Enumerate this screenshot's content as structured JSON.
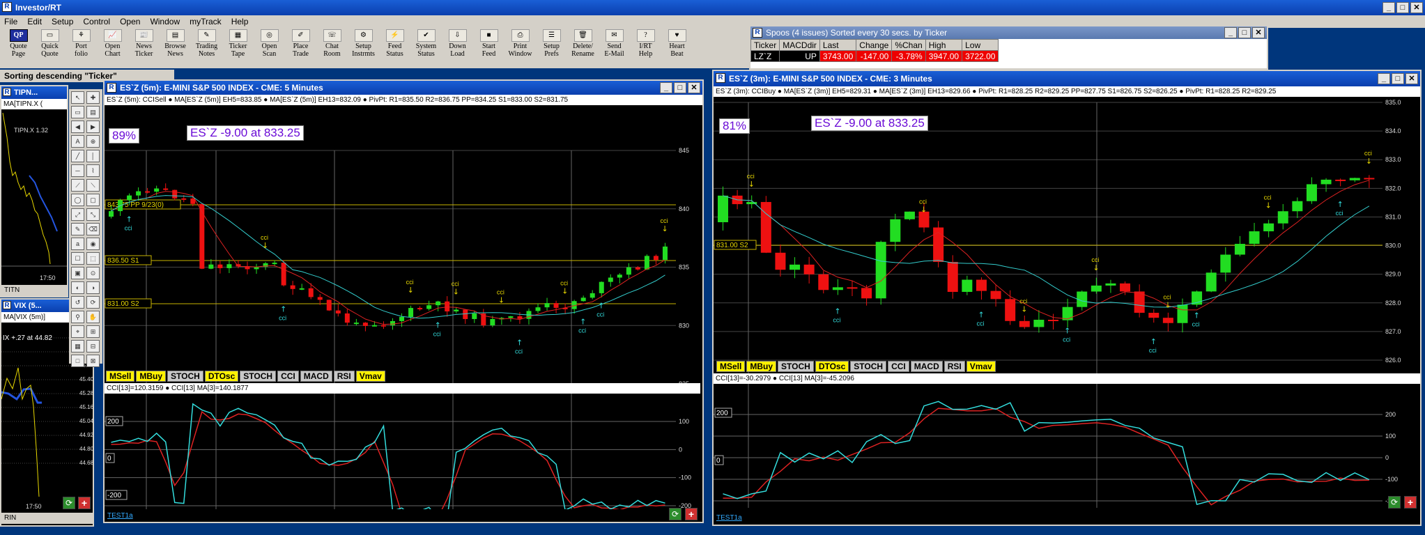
{
  "app": {
    "title": "Investor/RT"
  },
  "menu": [
    "File",
    "Edit",
    "Setup",
    "Control",
    "Open",
    "Window",
    "myTrack",
    "Help"
  ],
  "toolbar": [
    [
      "Quote",
      "Page",
      "QP"
    ],
    [
      "Quick",
      "Quote",
      "▭"
    ],
    [
      "Port",
      "folio",
      "⚘"
    ],
    [
      "Open",
      "Chart",
      "📈"
    ],
    [
      "News",
      "Ticker",
      "📰"
    ],
    [
      "Browse",
      "News",
      "▤"
    ],
    [
      "Trading",
      "Notes",
      "✎"
    ],
    [
      "Ticker",
      "Tape",
      "▦"
    ],
    [
      "Open",
      "Scan",
      "◎"
    ],
    [
      "Place",
      "Trade",
      "✐"
    ],
    [
      "Chat",
      "Room",
      "☏"
    ],
    [
      "Setup",
      "Instrmts",
      "⚙"
    ],
    [
      "Feed",
      "Status",
      "⚡"
    ],
    [
      "System",
      "Status",
      "✔"
    ],
    [
      "Down",
      "Load",
      "⇩"
    ],
    [
      "Start",
      "Feed",
      "■"
    ],
    [
      "Print",
      "Window",
      "⎙"
    ],
    [
      "Setup",
      "Prefs",
      "☰"
    ],
    [
      "Delete/",
      "Rename",
      "🗑"
    ],
    [
      "Send",
      "E-Mail",
      "✉"
    ],
    [
      "I/RT",
      "Help",
      "?"
    ],
    [
      "Heart",
      "Beat",
      "♥"
    ]
  ],
  "sort_text": "Sorting descending \"Ticker\"",
  "quote_win": {
    "title": "Spoos (4 issues) Sorted every 30 secs. by Ticker",
    "headers": [
      "Ticker",
      "MACDdir",
      "Last",
      "Change",
      "%Chan",
      "High",
      "Low"
    ],
    "row": [
      "LZ`Z",
      "UP",
      "3743.00",
      "-147.00",
      "-3.78%",
      "3947.00",
      "3722.00"
    ]
  },
  "tipn": {
    "title": "TIPN...",
    "ma": "MA[TIPN.X (",
    "price": "TIPN.X 1.32",
    "time": "17:50",
    "status": "TITN"
  },
  "vix": {
    "title": "VIX (5...",
    "ma": "MA[VIX (5m)]",
    "change": "IX +.27 at 44.82",
    "ticks": [
      "45.76",
      "45.64",
      "45.52",
      "45.40",
      "45.28",
      "45.16",
      "45.04",
      "44.92",
      "44.80",
      "44.68"
    ],
    "time": "17:50",
    "status": "RIN"
  },
  "chart5": {
    "title": "ES`Z (5m): E-MINI S&P 500 INDEX - CME: 5 Minutes",
    "legend": "ES`Z (5m): CCISell  ● MA[ES`Z (5m)] EH5=833.85  ● MA[ES`Z (5m)] EH13=832.09  ● PivPt: R1=835.50 R2=836.75 PP=834.25 S1=833.00 S2=831.75",
    "pct": "89%",
    "info": "ES`Z -9.00 at 833.25",
    "hlines": [
      "843.75 PP 9/23(0)",
      "836.50 S1",
      "831.00 S2"
    ],
    "yticks": [
      "845",
      "840",
      "835",
      "830",
      "825"
    ],
    "xticks": [
      "20:30",
      "14:30",
      "15:30",
      "16:30",
      "17:30"
    ],
    "tabs": [
      "MSell",
      "MBuy",
      "STOCH",
      "DTOsc",
      "STOCH",
      "CCI",
      "MACD",
      "RSI",
      "Vmav"
    ],
    "cci_legend": "CCI[13]=120.3159  ● CCI[13] MA[3]=140.1877",
    "cci_marks": [
      "200",
      "0",
      "-200"
    ],
    "cci_yticks": [
      "100",
      "0",
      "-100",
      "-200"
    ],
    "status": "TEST1a"
  },
  "chart3": {
    "title": "ES`Z (3m): E-MINI S&P 500 INDEX - CME: 3 Minutes",
    "legend": "ES`Z (3m): CCIBuy  ● MA[ES`Z (3m)] EH5=829.31  ● MA[ES`Z (3m)] EH13=829.66  ● PivPt: R1=828.25 R2=829.25 PP=827.75 S1=826.75 S2=826.25  ● PivPt: R1=828.25 R2=829.25",
    "pct": "81%",
    "info": "ES`Z -9.00 at 833.25",
    "hline": "831.00 S2",
    "yticks": [
      "835.0",
      "834.0",
      "833.0",
      "832.0",
      "831.0",
      "830.0",
      "829.0",
      "828.0",
      "827.0",
      "826.0"
    ],
    "xticks": [
      "16:30",
      "17:30"
    ],
    "tabs": [
      "MSell",
      "MBuy",
      "STOCH",
      "DTOsc",
      "STOCH",
      "CCI",
      "MACD",
      "RSI",
      "Vmav"
    ],
    "cci_legend": "CCI[13]=-30.2979  ● CCI[13] MA[3]=-45.2096",
    "cci_marks": [
      "200",
      "0"
    ],
    "cci_yticks": [
      "200",
      "100",
      "0",
      "-100",
      "-200"
    ],
    "status": "TEST1a"
  },
  "signal_label": "cci",
  "colors": {
    "up": "#22dd22",
    "down": "#ee1111",
    "cyan": "#33dddd",
    "red": "#dd2222",
    "yellow": "#e8d800"
  }
}
